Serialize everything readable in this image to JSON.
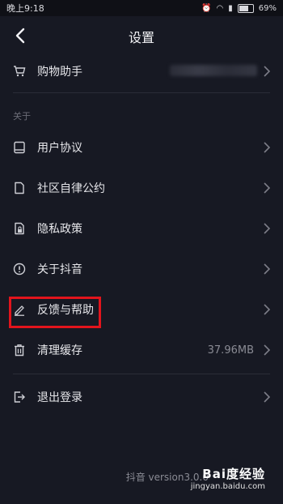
{
  "status": {
    "time": "晚上9:18",
    "battery": "69%"
  },
  "nav": {
    "title": "设置"
  },
  "top_item": {
    "label": "购物助手"
  },
  "section": {
    "label": "关于"
  },
  "items": [
    {
      "label": "用户协议",
      "icon": "book-icon"
    },
    {
      "label": "社区自律公约",
      "icon": "document-icon"
    },
    {
      "label": "隐私政策",
      "icon": "lock-document-icon"
    },
    {
      "label": "关于抖音",
      "icon": "info-icon"
    },
    {
      "label": "反馈与帮助",
      "icon": "pen-icon"
    }
  ],
  "cache": {
    "label": "清理缓存",
    "value": "37.96MB"
  },
  "logout": {
    "label": "退出登录"
  },
  "footer": {
    "version": "抖音 version3.0.0"
  },
  "watermark": {
    "brand": "Bai度经验",
    "url": "jingyan.baidu.com"
  },
  "colors": {
    "background": "#171923",
    "highlight": "#e2141c"
  }
}
